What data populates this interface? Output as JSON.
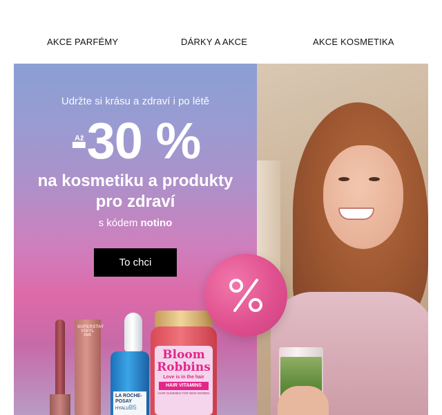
{
  "nav": {
    "items": [
      {
        "label": "AKCE PARFÉMY"
      },
      {
        "label": "DÁRKY A AKCE"
      },
      {
        "label": "AKCE KOSMETIKA"
      }
    ]
  },
  "banner": {
    "subtitle": "Udržte si krásu a zdraví i po létě",
    "upto": "Až",
    "discount": "-30 %",
    "headline_line1": "na kosmetiku a produkty",
    "headline_line2": "pro zdraví",
    "code_prefix": "s kódem",
    "code": "notino",
    "cta_label": "To chci",
    "badge_icon": "percent-icon"
  },
  "products": {
    "lipstick_brand": "SUPERSTAY VINYL INK",
    "serum_brand": "LA ROCHE-POSAY",
    "serum_name": "HYALU",
    "serum_suffix": "B5",
    "gummy_brand": "Bloom Robbins",
    "gummy_tagline": "Love is in the hair",
    "gummy_product": "HAIR VITAMINS",
    "gummy_small": "HAIR GUMMIES FOR NEW WOMEN"
  },
  "colors": {
    "cta_bg": "#000000",
    "badge": "#e0508f",
    "gummy_pink": "#e3268a"
  }
}
